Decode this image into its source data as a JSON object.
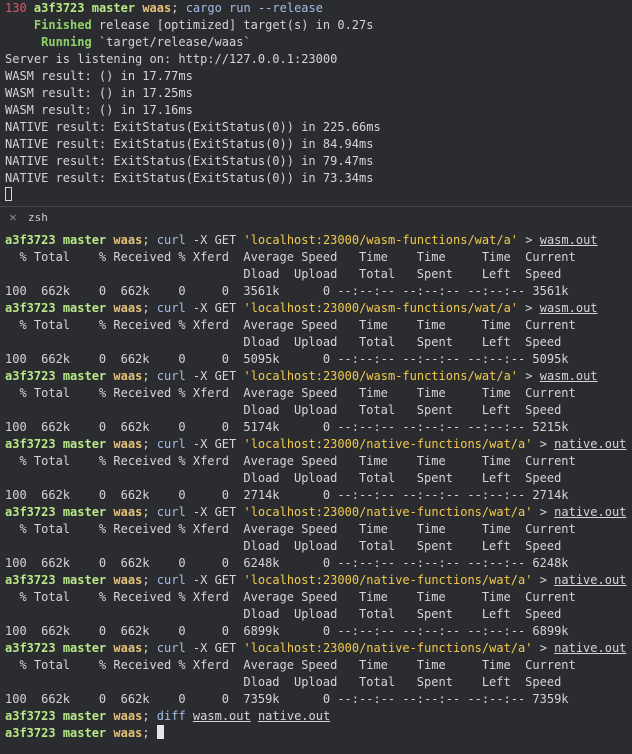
{
  "prompt": {
    "hash": "a3f3723",
    "branch": "master",
    "dir": "waas",
    "sep": ";"
  },
  "top": {
    "exit_code": "130",
    "command": "cargo run --release",
    "finished_word": "Finished",
    "finished_text": " release [optimized] target(s) in 0.27s",
    "running_word": "Running",
    "running_text": " `target/release/waas`",
    "output_lines": [
      "Server is listening on: http://127.0.0.1:23000",
      "WASM result: () in 17.77ms",
      "WASM result: () in 17.25ms",
      "WASM result: () in 17.16ms",
      "NATIVE result: ExitStatus(ExitStatus(0)) in 225.66ms",
      "NATIVE result: ExitStatus(ExitStatus(0)) in 84.94ms",
      "NATIVE result: ExitStatus(ExitStatus(0)) in 79.47ms",
      "NATIVE result: ExitStatus(ExitStatus(0)) in 73.34ms"
    ]
  },
  "tab": {
    "close_glyph": "✕",
    "label": "zsh"
  },
  "curl": {
    "cmd": "curl",
    "args": " -X GET ",
    "redirect": " > ",
    "header1": "  % Total    % Received % Xferd  Average Speed   Time    Time     Time  Current",
    "header2": "                                 Dload  Upload   Total   Spent    Left  Speed",
    "runs": [
      {
        "url": "'localhost:23000/wasm-functions/wat/a'",
        "outfile": "wasm.out",
        "result": "100  662k    0  662k    0     0  3561k      0 --:--:-- --:--:-- --:--:-- 3561k"
      },
      {
        "url": "'localhost:23000/wasm-functions/wat/a'",
        "outfile": "wasm.out",
        "result": "100  662k    0  662k    0     0  5095k      0 --:--:-- --:--:-- --:--:-- 5095k"
      },
      {
        "url": "'localhost:23000/wasm-functions/wat/a'",
        "outfile": "wasm.out",
        "result": "100  662k    0  662k    0     0  5174k      0 --:--:-- --:--:-- --:--:-- 5215k"
      },
      {
        "url": "'localhost:23000/native-functions/wat/a'",
        "outfile": "native.out",
        "result": "100  662k    0  662k    0     0  2714k      0 --:--:-- --:--:-- --:--:-- 2714k"
      },
      {
        "url": "'localhost:23000/native-functions/wat/a'",
        "outfile": "native.out",
        "result": "100  662k    0  662k    0     0  6248k      0 --:--:-- --:--:-- --:--:-- 6248k"
      },
      {
        "url": "'localhost:23000/native-functions/wat/a'",
        "outfile": "native.out",
        "result": "100  662k    0  662k    0     0  6899k      0 --:--:-- --:--:-- --:--:-- 6899k"
      },
      {
        "url": "'localhost:23000/native-functions/wat/a'",
        "outfile": "native.out",
        "result": "100  662k    0  662k    0     0  7359k      0 --:--:-- --:--:-- --:--:-- 7359k"
      }
    ]
  },
  "diff": {
    "cmd": "diff",
    "file1": "wasm.out",
    "file2": "native.out"
  }
}
